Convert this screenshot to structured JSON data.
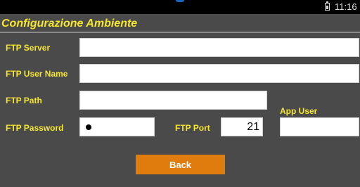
{
  "status_bar": {
    "time": "11:16",
    "battery_icon": "battery-charging-icon"
  },
  "screen": {
    "title": "Configurazione Ambiente"
  },
  "form": {
    "ftp_server": {
      "label": "FTP Server",
      "value": ""
    },
    "ftp_user_name": {
      "label": "FTP User Name",
      "value": ""
    },
    "ftp_path": {
      "label": "FTP Path",
      "value": ""
    },
    "ftp_password": {
      "label": "FTP Password",
      "masked_value": "●"
    },
    "ftp_port": {
      "label": "FTP Port",
      "value": "21"
    },
    "app_user": {
      "label": "App User",
      "value": ""
    }
  },
  "actions": {
    "back_label": "Back"
  },
  "colors": {
    "background": "#4a4a4a",
    "label_yellow": "#f5e631",
    "button_orange": "#e07b0e",
    "status_bar": "#000000"
  }
}
